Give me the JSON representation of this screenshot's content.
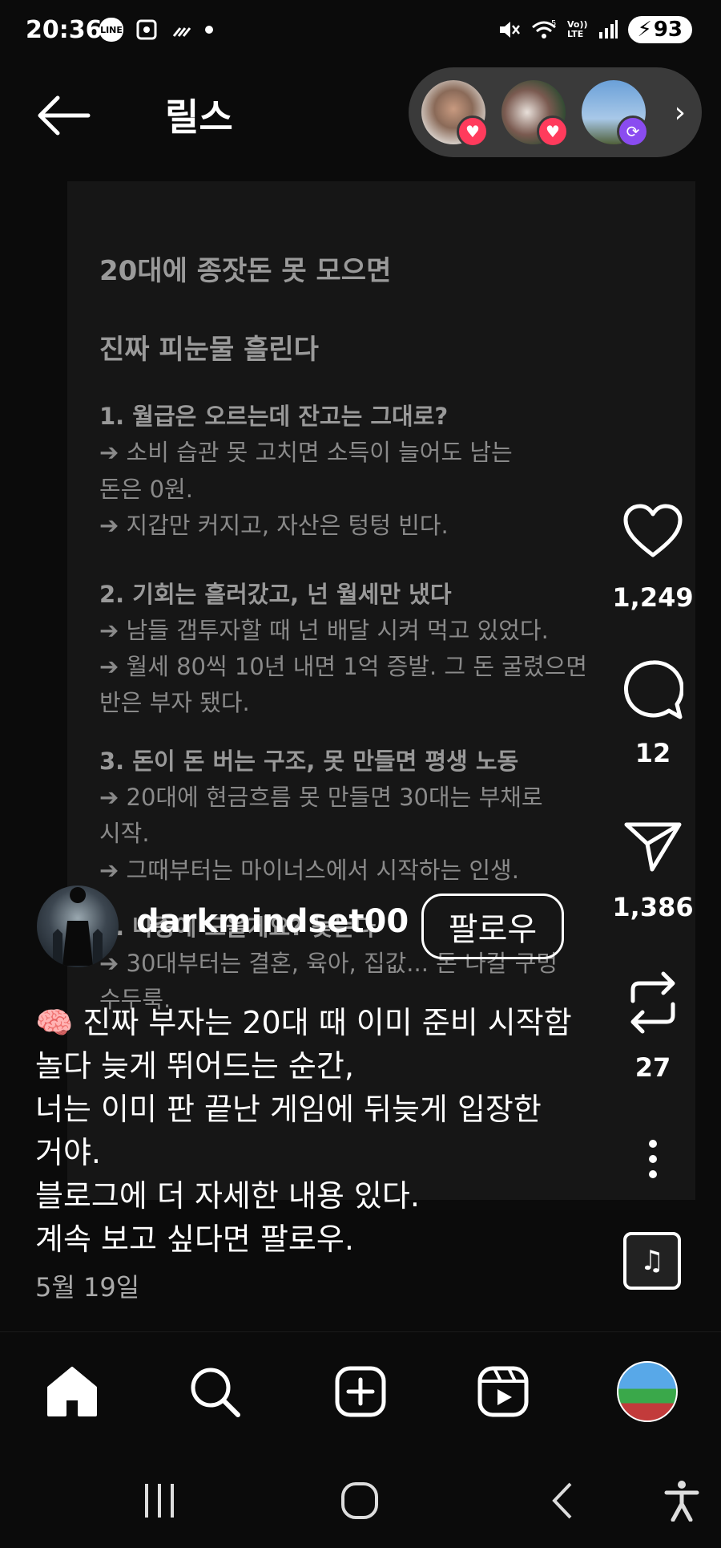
{
  "status_bar": {
    "time": "20:36",
    "line_icon_text": "LINE",
    "battery": "93",
    "network_5": "5",
    "volte": "Vo)) LTE"
  },
  "header": {
    "title": "릴스",
    "back_icon": "arrow-left-icon"
  },
  "stories": [
    {
      "badge_icon": "heart-icon",
      "badge_color": "#ff3b5c"
    },
    {
      "badge_icon": "heart-icon",
      "badge_color": "#ff3b5c"
    },
    {
      "badge_icon": "repost-icon",
      "badge_color": "#8a4cf0"
    }
  ],
  "post": {
    "title_1": "20대에 종잣돈 못 모으면",
    "title_2": "진짜 피눈물 흘린다",
    "lines": [
      {
        "text": "1.  월급은 오르는데 잔고는 그대로?",
        "bold": true
      },
      {
        "text": "   ➔ 소비 습관 못 고치면 소득이 늘어도 남는",
        "bold": false
      },
      {
        "text": "돈은 0원.",
        "bold": false
      },
      {
        "text": "   ➔ 지갑만 커지고, 자산은 텅텅 빈다.",
        "bold": false
      },
      {
        "text": "2.  기회는 흘러갔고, 넌 월세만 냈다",
        "bold": true
      },
      {
        "text": "   ➔ 남들 갭투자할 때 넌 배달 시켜 먹고 있었다.",
        "bold": false
      },
      {
        "text": "   ➔ 월세 80씩 10년 내면 1억 증발. 그 돈 굴렸으면",
        "bold": false
      },
      {
        "text": "반은 부자 됐다.",
        "bold": false
      },
      {
        "text": "3.  돈이 돈 버는 구조, 못 만들면 평생 노동",
        "bold": true
      },
      {
        "text": "   ➔ 20대에 현금흐름 못 만들면 30대는 부채로",
        "bold": false
      },
      {
        "text": "시작.",
        "bold": false
      },
      {
        "text": "   ➔ 그때부터는 마이너스에서 시작하는 인생.",
        "bold": false
      },
      {
        "text": "4.  나중에 모을게요? 늦는다",
        "bold": true
      },
      {
        "text": "   ➔ 30대부터는 결혼, 육아, 집값... 돈 나갈 구멍",
        "bold": false
      },
      {
        "text": "수두룩.",
        "bold": false
      }
    ]
  },
  "actions": {
    "likes": "1,249",
    "comments": "12",
    "shares": "1,386",
    "reposts": "27"
  },
  "user": {
    "username": "darkmindset00",
    "follow_label": "팔로우"
  },
  "caption": {
    "lines": [
      "🧠 진짜 부자는 20대 때 이미 준비 시작함",
      "놀다 늦게 뛰어드는 순간,",
      "너는 이미 판 끝난 게임에 뒤늦게 입장한",
      "거야.",
      "블로그에 더 자세한 내용 있다.",
      "계속 보고 싶다면 팔로우."
    ],
    "date": "5월 19일"
  },
  "bottom_nav": [
    "home-icon",
    "search-icon",
    "create-icon",
    "reels-icon",
    "profile-avatar"
  ],
  "system_nav": [
    "recents-icon",
    "home-circle-icon",
    "back-chevron-icon",
    "accessibility-icon"
  ]
}
